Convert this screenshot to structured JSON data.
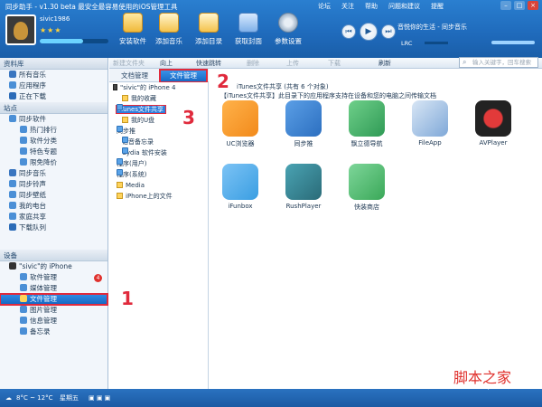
{
  "window": {
    "title": "同步助手 - v1.30 beta  最安全最容易使用的iOS管理工具",
    "menu": [
      "论坛",
      "关注",
      "帮助",
      "问题和建议",
      "提醒"
    ]
  },
  "user": {
    "name": "sivic1986",
    "stars": "★★★"
  },
  "toolbar": {
    "install": "安装软件",
    "add_music": "添加音乐",
    "add_dir": "添加目录",
    "get_cover": "获取封面",
    "settings": "参数设置"
  },
  "player": {
    "now_playing": "音悦你的生活 - 同步音乐",
    "lrc": "LRC"
  },
  "sections": {
    "library": "资料库",
    "station": "站点",
    "device": "设备"
  },
  "library_items": [
    "所有音乐",
    "应用程序",
    "正在下载"
  ],
  "station_items": [
    "同步软件",
    "热门排行",
    "软件分类",
    "特色专题",
    "限免降价",
    "同步音乐",
    "同步铃声",
    "同步壁纸",
    "我的电台",
    "家庭共享",
    "下载队列"
  ],
  "device": {
    "name": "\"sivic\"的 iPhone",
    "badge": "4"
  },
  "device_items": [
    "软件管理",
    "媒体管理",
    "文件管理",
    "图片管理",
    "信息管理",
    "备忘录"
  ],
  "toolbar2": {
    "new_folder": "新建文件夹",
    "up": "向上",
    "quick_jump": "快速跳转",
    "delete": "删除",
    "upload": "上传",
    "download": "下载",
    "refresh": "刷新",
    "search_placeholder": "输入关键字，回车搜索"
  },
  "tabs": {
    "doc": "文档管理",
    "file": "文件管理"
  },
  "tree": [
    "\"sivic\"的 iPhone 4",
    "我的收藏",
    "iTunes文件共享",
    "我的U盘",
    "同步推",
    "语音备忘录",
    "Cydia 软件安装",
    "程序(用户)",
    "程序(系统)",
    "Media",
    "iPhone上的文件"
  ],
  "content": {
    "header": "iTunes文件共享 (共有 6 个对象)",
    "note": "【iTunes文件共享】此目录下的应用程序支持在设备和您的电脑之间传输文档"
  },
  "apps": [
    {
      "name": "UC浏览器",
      "color": "#f28a1b"
    },
    {
      "name": "同步推",
      "color": "#2c6fc0"
    },
    {
      "name": "飘立德导航",
      "color": "#2f9a55"
    },
    {
      "name": "FileApp",
      "color": "#7fa8d8"
    },
    {
      "name": "AVPlayer",
      "color": "#b3141c"
    },
    {
      "name": "iFunbox",
      "color": "#3a9ee2"
    },
    {
      "name": "RushPlayer",
      "color": "#2a6b78"
    },
    {
      "name": "快装商店",
      "color": "#3aa858"
    }
  ],
  "annotations": [
    "1",
    "2",
    "3"
  ],
  "status": {
    "weather": "8°C ~ 12°C",
    "day": "星期五"
  },
  "watermark": {
    "text": "脚本之家",
    "url": "www.jb51.net"
  }
}
